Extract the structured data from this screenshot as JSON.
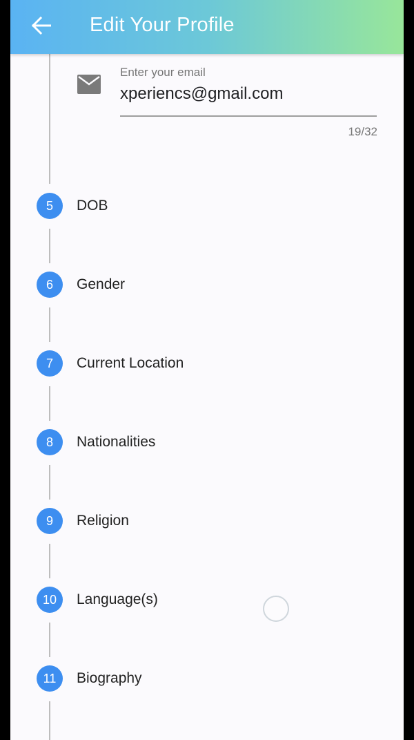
{
  "appbar": {
    "title": "Edit Your Profile",
    "back_icon": "arrow-left-icon"
  },
  "email": {
    "icon": "mail-icon",
    "label": "Enter your email",
    "value": "xperiencs@gmail.com",
    "counter": "19/32"
  },
  "steps": [
    {
      "number": "5",
      "label": "DOB"
    },
    {
      "number": "6",
      "label": "Gender"
    },
    {
      "number": "7",
      "label": "Current Location"
    },
    {
      "number": "8",
      "label": "Nationalities"
    },
    {
      "number": "9",
      "label": "Religion"
    },
    {
      "number": "10",
      "label": "Language(s)"
    },
    {
      "number": "11",
      "label": "Biography"
    }
  ],
  "colors": {
    "appbar_gradient_start": "#5ab3f3",
    "appbar_gradient_end": "#98e69a",
    "step_circle": "#3d8ef0",
    "connector": "#bdbdbd"
  }
}
